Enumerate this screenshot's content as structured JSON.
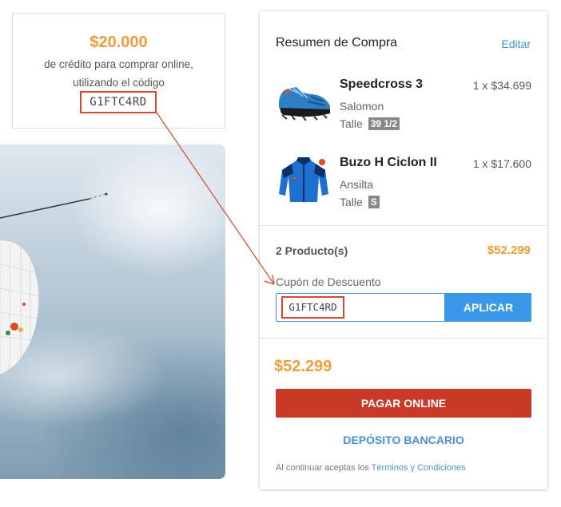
{
  "promo": {
    "amount": "$20.000",
    "line1": "de crédito para comprar online,",
    "line2": "utilizando el código",
    "code": "G1FTC4RD"
  },
  "summary": {
    "title": "Resumen de Compra",
    "edit_label": "Editar",
    "products": [
      {
        "name": "Speedcross 3",
        "quantity_price": "1 x $34.699",
        "brand": "Salomon",
        "size_label": "Talle",
        "size": "39 1/2",
        "icon": "shoe-icon"
      },
      {
        "name": "Buzo H Ciclon II",
        "quantity_price": "1 x $17.600",
        "brand": "Ansilta",
        "size_label": "Talle",
        "size": "S",
        "icon": "jacket-icon"
      }
    ],
    "count_label": "2 Producto(s)",
    "subtotal": "$52.299",
    "coupon": {
      "label": "Cupón de Descuento",
      "value": "G1FTC4RD",
      "apply_label": "APLICAR"
    },
    "total": "$52.299",
    "pay_label": "PAGAR ONLINE",
    "deposit_label": "DEPÓSITO BANCARIO",
    "terms_prefix": "Al continuar aceptas los ",
    "terms_link": "Términos y Condiciones"
  },
  "colors": {
    "accent_orange": "#f29c38",
    "link_blue": "#4a90d9",
    "apply_blue": "#3b98e8",
    "pay_red": "#c83a25",
    "highlight_red": "#d9452c"
  }
}
